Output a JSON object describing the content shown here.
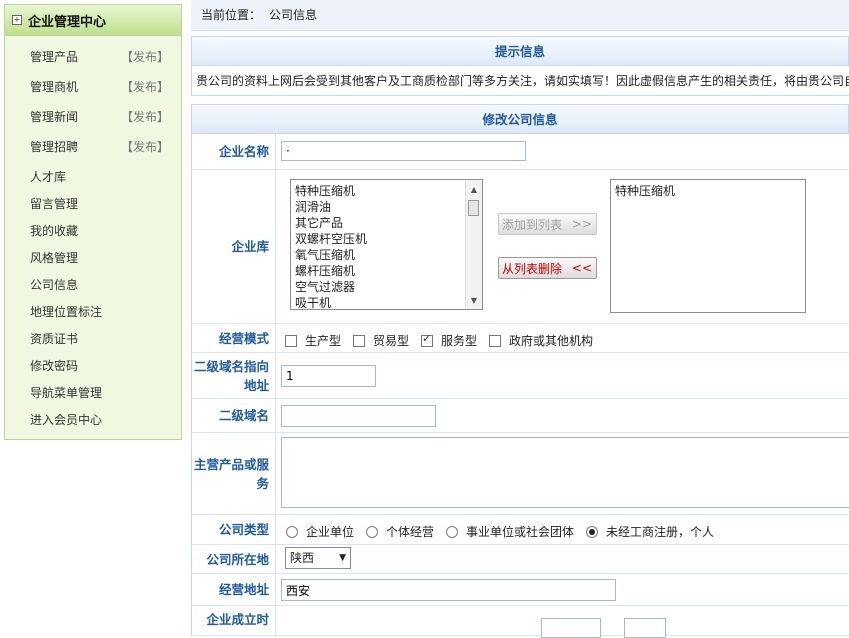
{
  "sidebar": {
    "title": "企业管理中心",
    "items": [
      {
        "label": "管理产品",
        "publish": "【发布】"
      },
      {
        "label": "管理商机",
        "publish": "【发布】"
      },
      {
        "label": "管理新闻",
        "publish": "【发布】"
      },
      {
        "label": "管理招聘",
        "publish": "【发布】"
      },
      {
        "label": "人才库"
      },
      {
        "label": "留言管理"
      },
      {
        "label": "我的收藏"
      },
      {
        "label": "风格管理"
      },
      {
        "label": "公司信息"
      },
      {
        "label": "地理位置标注"
      },
      {
        "label": "资质证书"
      },
      {
        "label": "修改密码"
      },
      {
        "label": "导航菜单管理"
      },
      {
        "label": "进入会员中心"
      }
    ]
  },
  "breadcrumb": {
    "label": "当前位置：",
    "value": "公司信息"
  },
  "notice": {
    "title": "提示信息",
    "text": "贵公司的资料上网后会受到其他客户及工商质检部门等多方关注，请如实填写！因此虚假信息产生的相关责任，将由贵公司自"
  },
  "form": {
    "title": "修改公司信息",
    "company_name": {
      "label": "企业名称",
      "value": "·"
    },
    "library": {
      "label": "企业库",
      "options": [
        "特种压缩机",
        "润滑油",
        "其它产品",
        "双螺杆空压机",
        "氧气压缩机",
        "螺杆压缩机",
        "空气过滤器",
        "吸干机"
      ],
      "add_button": "添加到列表",
      "add_arrows": ">>",
      "remove_button": "从列表删除",
      "remove_arrows": "<<",
      "selected": [
        "特种压缩机"
      ]
    },
    "business_mode": {
      "label": "经营模式",
      "options": [
        {
          "label": "生产型",
          "checked": false
        },
        {
          "label": "贸易型",
          "checked": false
        },
        {
          "label": "服务型",
          "checked": true
        },
        {
          "label": "政府或其他机构",
          "checked": false
        }
      ]
    },
    "subdomain_target": {
      "label": "二级域名指向地址",
      "value": "1"
    },
    "subdomain": {
      "label": "二级域名",
      "value": ""
    },
    "main_products": {
      "label": "主营产品或服务",
      "value": ""
    },
    "company_type": {
      "label": "公司类型",
      "options": [
        {
          "label": "企业单位",
          "selected": false
        },
        {
          "label": "个体经营",
          "selected": false
        },
        {
          "label": "事业单位或社会团体",
          "selected": false
        },
        {
          "label": "未经工商注册，个人",
          "selected": true
        }
      ]
    },
    "location": {
      "label": "公司所在地",
      "value": "陕西"
    },
    "address": {
      "label": "经营地址",
      "value": "西安"
    },
    "founded": {
      "label": "企业成立时"
    }
  }
}
